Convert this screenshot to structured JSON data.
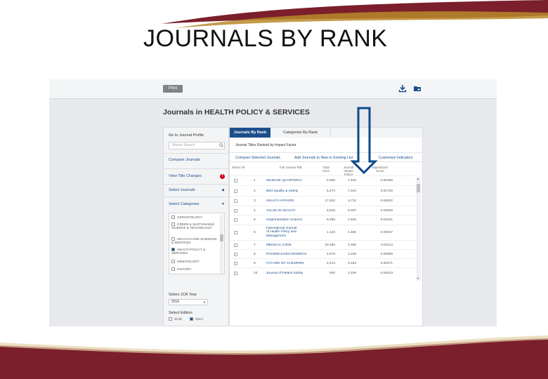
{
  "slide": {
    "title": "JOURNALS BY RANK",
    "colors": {
      "maroon": "#7a1f2b",
      "gold": "#b98a2a",
      "link_blue": "#1b4f8a",
      "tab_blue": "#1b4f8a"
    }
  },
  "toolbar": {
    "print_label": "Print",
    "download_icon": "download-icon",
    "folder_icon": "add-to-folder-icon"
  },
  "page": {
    "heading": "Journals in HEALTH POLICY & SERVICES"
  },
  "sidebar": {
    "goto_label": "Go to Journal Profile",
    "search_placeholder": "Master Search",
    "compare_link": "Compare Journals",
    "view_title_changes": "View Title Changes",
    "select_journals": "Select Journals",
    "select_categories": "Select Categories",
    "categories": [
      {
        "label": "GERONTOLOGY",
        "checked": false
      },
      {
        "label": "GREEN & SUSTAINABLE SCIENCE & TECHNOLOGY",
        "checked": false
      },
      {
        "label": "HEALTH CARE SCIENCES & SERVICES",
        "checked": false
      },
      {
        "label": "HEALTH POLICY & SERVICES",
        "checked": true
      },
      {
        "label": "HEMATOLOGY",
        "checked": false
      },
      {
        "label": "HISTORY",
        "checked": false
      }
    ],
    "jcr_year_label": "Select JCR Year",
    "jcr_year_value": "2016",
    "edition_label": "Select Edition",
    "editions": [
      {
        "label": "SCIE",
        "checked": false
      },
      {
        "label": "SSCI",
        "checked": true
      }
    ]
  },
  "main": {
    "tabs": [
      "Journals By Rank",
      "Categories By Rank"
    ],
    "subtitle": "Journal Titles Ranked by Impact Factor",
    "actions": [
      "Compare Selected Journals",
      "Add Journals to New or Existing List",
      "Customize Indicators"
    ],
    "columns": [
      "Select All",
      "Full Journal Title",
      "Total Cites",
      "Journal Impact Factor",
      "Eigenfactor Score"
    ],
    "rows": [
      {
        "rank": "1",
        "title": "MILBANK QUARTERLY",
        "cites": "5,956",
        "jif": "7.426",
        "eigen": "0.00495"
      },
      {
        "rank": "2",
        "title": "BMJ Quality & Safety",
        "cites": "5,274",
        "jif": "7.343",
        "eigen": "0.01729"
      },
      {
        "rank": "3",
        "title": "HEALTH AFFAIRS",
        "cites": "17,240",
        "jif": "5.711",
        "eigen": "0.05632"
      },
      {
        "rank": "4",
        "title": "VALUE IN HEALTH",
        "cites": "8,615",
        "jif": "5.037",
        "eigen": "0.02629"
      },
      {
        "rank": "5",
        "title": "Implementation Science",
        "cites": "8,295",
        "jif": "4.525",
        "eigen": "0.01631"
      },
      {
        "rank": "6",
        "title": "International Journal of Health Policy and Management",
        "cites": "1,140",
        "jif": "4.485",
        "eigen": "0.00347"
      },
      {
        "rank": "7",
        "title": "MEDICAL CARE",
        "cites": "20,450",
        "jif": "3.295",
        "eigen": "0.02114"
      },
      {
        "rank": "8",
        "title": "PHARMACOECONOMICS",
        "cites": "4,575",
        "jif": "3.235",
        "eigen": "0.00855"
      },
      {
        "rank": "9",
        "title": "FUTURE OF CHILDREN",
        "cites": "2,213",
        "jif": "3.193",
        "eigen": "0.00271"
      },
      {
        "rank": "10",
        "title": "Journal of Patient Safety",
        "cites": "940",
        "jif": "3.109",
        "eigen": "0.00243"
      }
    ]
  }
}
